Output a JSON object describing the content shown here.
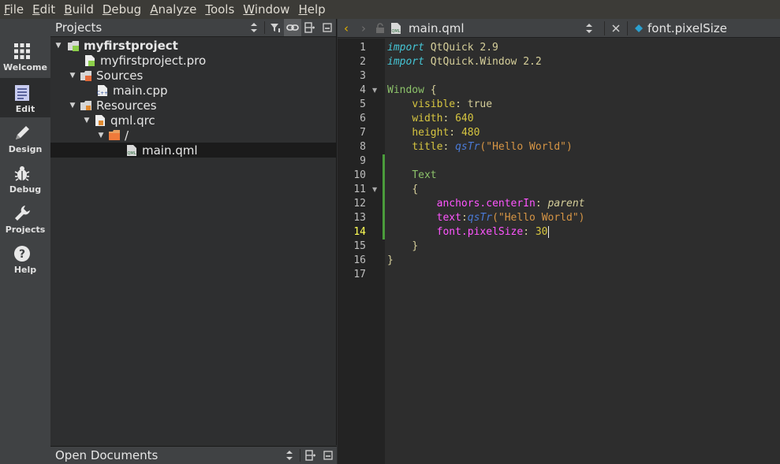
{
  "menu": [
    {
      "underline": "F",
      "rest": "ile"
    },
    {
      "underline": "E",
      "rest": "dit"
    },
    {
      "underline": "B",
      "rest": "uild"
    },
    {
      "underline": "D",
      "rest": "ebug"
    },
    {
      "underline": "A",
      "rest": "nalyze"
    },
    {
      "underline": "T",
      "rest": "ools"
    },
    {
      "underline": "W",
      "rest": "indow"
    },
    {
      "underline": "H",
      "rest": "elp"
    }
  ],
  "modes": [
    {
      "label": "Welcome",
      "icon": "grid-icon"
    },
    {
      "label": "Edit",
      "icon": "document-edit-icon"
    },
    {
      "label": "Design",
      "icon": "pen-icon"
    },
    {
      "label": "Debug",
      "icon": "bug-icon"
    },
    {
      "label": "Projects",
      "icon": "wrench-icon"
    },
    {
      "label": "Help",
      "icon": "question-icon"
    }
  ],
  "projects": {
    "title": "Projects",
    "tree": [
      {
        "label": "myfirstproject",
        "bold": true
      },
      {
        "label": "myfirstproject.pro"
      },
      {
        "label": "Sources"
      },
      {
        "label": "main.cpp"
      },
      {
        "label": "Resources"
      },
      {
        "label": "qml.qrc"
      },
      {
        "label": "/"
      },
      {
        "label": "main.qml"
      }
    ]
  },
  "open_documents": {
    "title": "Open Documents"
  },
  "editor": {
    "file_name": "main.qml",
    "symbol": "font.pixelSize",
    "current_line": 14,
    "line_numbers": [
      "1",
      "2",
      "3",
      "4",
      "5",
      "6",
      "7",
      "8",
      "9",
      "10",
      "11",
      "12",
      "13",
      "14",
      "15",
      "16",
      "17"
    ],
    "code": {
      "l1_kw": "import",
      "l1_rest": " QtQuick 2.9",
      "l2_kw": "import",
      "l2_rest": " QtQuick.Window 2.2",
      "l4_type": "Window",
      "l4_rest": " {",
      "l5_prop": "visible",
      "l5_sep": ": ",
      "l5_val": "true",
      "l6_prop": "width",
      "l6_sep": ": ",
      "l6_val": "640",
      "l7_prop": "height",
      "l7_sep": ": ",
      "l7_val": "480",
      "l8_prop": "title",
      "l8_sep": ": ",
      "l8_fn": "qsTr",
      "l8_str": "(\"Hello World\")",
      "l10_type": "Text",
      "l11_brace": "{",
      "l12_prop": "anchors.centerIn",
      "l12_sep": ": ",
      "l12_val": "parent",
      "l13_prop": "text",
      "l13_sep": ":",
      "l13_fn": "qsTr",
      "l13_str": "(\"Hello World\")",
      "l14_prop": "font.pixelSize",
      "l14_sep": ": ",
      "l14_val": "30",
      "l15_brace": "}",
      "l16_brace": "}"
    }
  }
}
